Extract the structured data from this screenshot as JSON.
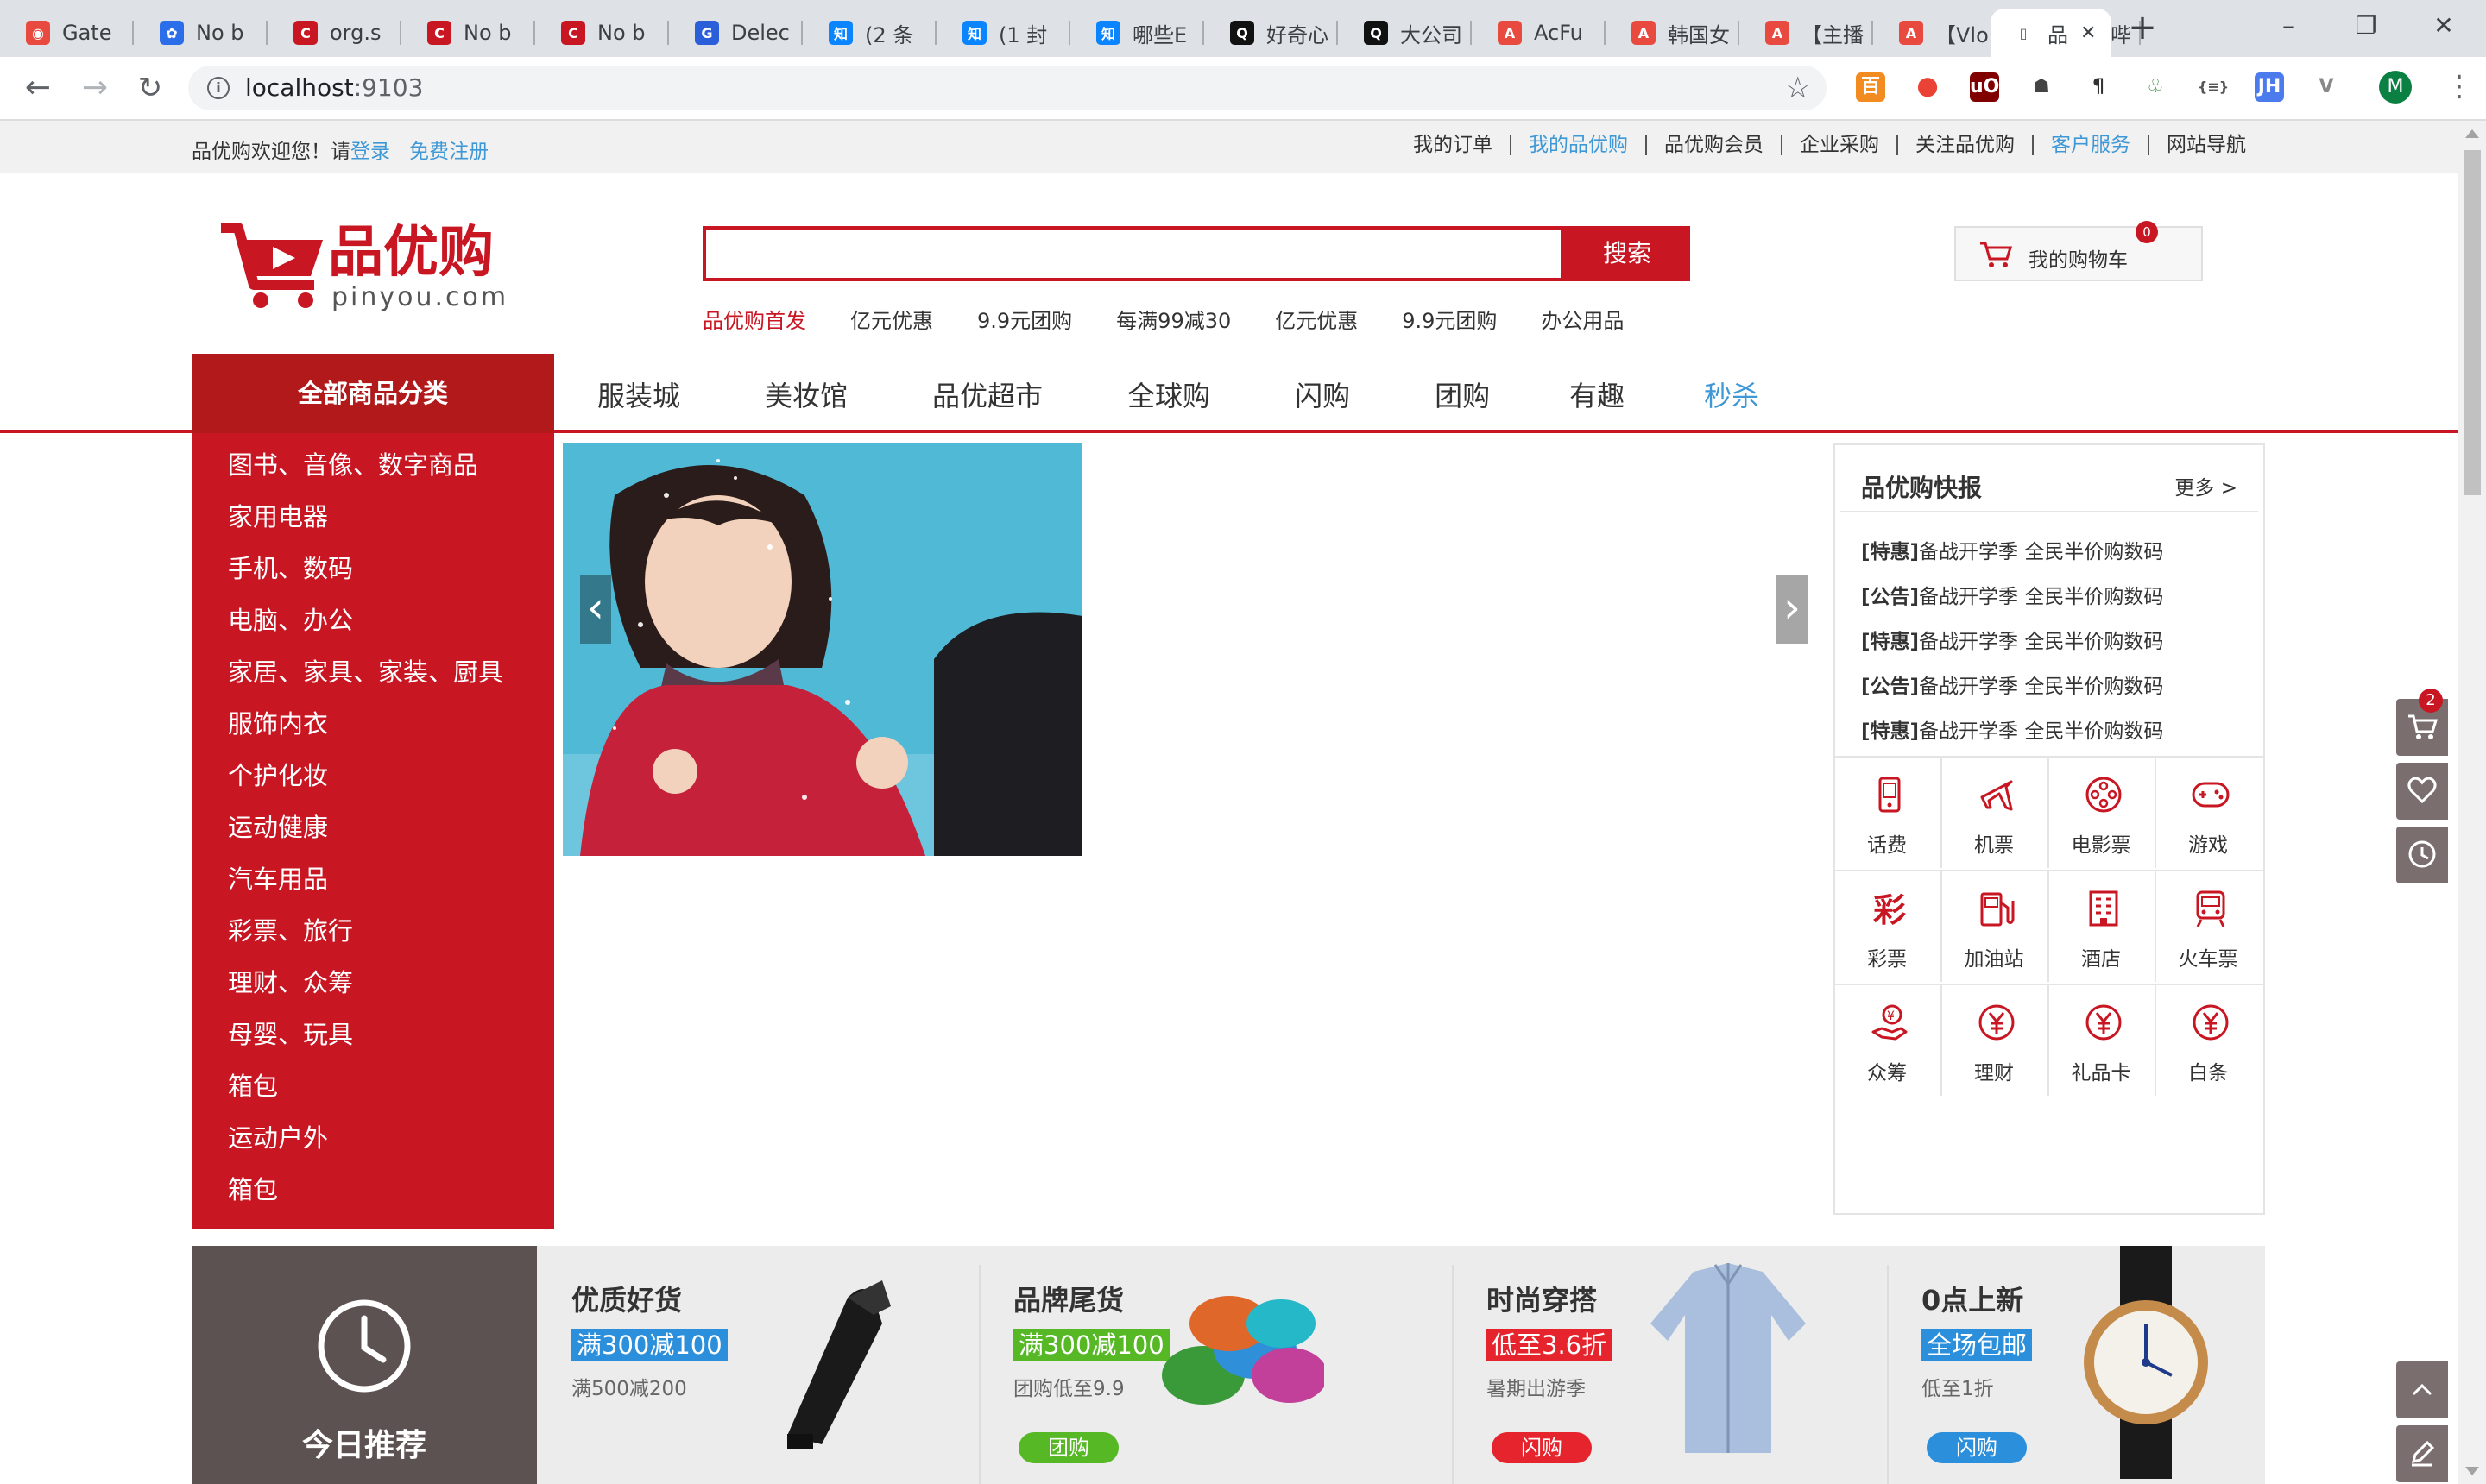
{
  "browser": {
    "tabs": [
      {
        "label": "Gate",
        "icon": "bilibili-icon",
        "color": "#e94a3f"
      },
      {
        "label": "No b",
        "icon": "baidu-icon",
        "color": "#2c6eea"
      },
      {
        "label": "org.s",
        "icon": "csdn-icon",
        "color": "#c81623"
      },
      {
        "label": "No b",
        "icon": "csdn-icon",
        "color": "#c81623"
      },
      {
        "label": "No b",
        "icon": "csdn-icon",
        "color": "#c81623"
      },
      {
        "label": "Delec",
        "icon": "google-icon",
        "color": "#2b5fd9"
      },
      {
        "label": "(2 条",
        "icon": "zhihu-icon",
        "color": "#0a84ff"
      },
      {
        "label": "(1 封",
        "icon": "zhihu-icon",
        "color": "#0a84ff"
      },
      {
        "label": "哪些E",
        "icon": "zhihu-icon",
        "color": "#0a84ff"
      },
      {
        "label": "好奇心",
        "icon": "qdaily-icon",
        "color": "#111111"
      },
      {
        "label": "大公司",
        "icon": "qdaily-icon",
        "color": "#111111"
      },
      {
        "label": "AcFu",
        "icon": "acfun-icon",
        "color": "#e94a3f"
      },
      {
        "label": "韩国女",
        "icon": "acfun-icon",
        "color": "#e94a3f"
      },
      {
        "label": "【主播",
        "icon": "acfun-icon",
        "color": "#e94a3f"
      },
      {
        "label": "【Vlo",
        "icon": "acfun-icon",
        "color": "#e94a3f"
      },
      {
        "label": "哔哩哔",
        "icon": "bilibili-tv-icon",
        "color": "#23ade5"
      },
      {
        "label": "品",
        "icon": "page-icon",
        "color": "#5f6368"
      }
    ],
    "url_host": "localhost",
    "url_port": ":9103",
    "extensions": [
      {
        "icon": "extension-orange-icon",
        "color": "#f28b20"
      },
      {
        "icon": "location-pin-icon",
        "color": "#ea4335"
      },
      {
        "icon": "ublock-icon",
        "color": "#800000"
      },
      {
        "icon": "spy-icon",
        "color": "#444444"
      },
      {
        "icon": "paragraph-icon",
        "color": "#333333"
      },
      {
        "icon": "leaf-icon",
        "color": "#2e7d32"
      },
      {
        "icon": "json-icon",
        "color": "#555555"
      },
      {
        "icon": "jh-icon",
        "color": "#4b7bec"
      },
      {
        "icon": "vue-icon",
        "color": "#888888"
      }
    ],
    "avatar_letter": "M"
  },
  "shortcut": {
    "welcome": "品优购欢迎您！请",
    "login": "登录",
    "register": "免费注册",
    "links": [
      "我的订单",
      "我的品优购",
      "品优购会员",
      "企业采购",
      "关注品优购",
      "客户服务",
      "网站导航"
    ]
  },
  "header": {
    "logo_cn": "品优购",
    "logo_en": "pinyou.com",
    "search_placeholder": "",
    "search_button": "搜索",
    "hotwords": [
      "品优购首发",
      "亿元优惠",
      "9.9元团购",
      "每满99减30",
      "亿元优惠",
      "9.9元团购",
      "办公用品"
    ],
    "cart_label": "我的购物车",
    "cart_count": "0"
  },
  "nav": {
    "category_title": "全部商品分类",
    "items": [
      "服装城",
      "美妆馆",
      "品优超市",
      "全球购",
      "闪购",
      "团购",
      "有趣",
      "秒杀"
    ]
  },
  "categories": [
    "图书、音像、数字商品",
    "家用电器",
    "手机、数码",
    "电脑、办公",
    "家居、家具、家装、厨具",
    "服饰内衣",
    "个护化妆",
    "运动健康",
    "汽车用品",
    "彩票、旅行",
    "理财、众筹",
    "母婴、玩具",
    "箱包",
    "运动户外",
    "箱包"
  ],
  "banner": {
    "prev": "‹",
    "next": "›"
  },
  "news": {
    "title": "品优购快报",
    "more": "更多 >",
    "items": [
      {
        "tag": "[特惠]",
        "text": "备战开学季 全民半价购数码"
      },
      {
        "tag": "[公告]",
        "text": "备战开学季 全民半价购数码"
      },
      {
        "tag": "[特惠]",
        "text": "备战开学季 全民半价购数码"
      },
      {
        "tag": "[公告]",
        "text": "备战开学季 全民半价购数码"
      },
      {
        "tag": "[特惠]",
        "text": "备战开学季 全民半价购数码"
      }
    ]
  },
  "services": [
    {
      "label": "话费",
      "icon": "phone-icon"
    },
    {
      "label": "机票",
      "icon": "airplane-icon"
    },
    {
      "label": "电影票",
      "icon": "film-reel-icon"
    },
    {
      "label": "游戏",
      "icon": "gamepad-icon"
    },
    {
      "label": "彩票",
      "icon": "lottery-icon"
    },
    {
      "label": "加油站",
      "icon": "gas-station-icon"
    },
    {
      "label": "酒店",
      "icon": "hotel-icon"
    },
    {
      "label": "火车票",
      "icon": "train-icon"
    },
    {
      "label": "众筹",
      "icon": "crowdfund-icon"
    },
    {
      "label": "理财",
      "icon": "yuan-coin-icon"
    },
    {
      "label": "礼品卡",
      "icon": "yuan-coin-icon"
    },
    {
      "label": "白条",
      "icon": "yuan-coin-icon"
    }
  ],
  "recommend": {
    "title": "今日推荐",
    "items": [
      {
        "title": "优质好货",
        "tag": "满300减100",
        "tag_color": "#2b8fdb",
        "sub": "满500减200",
        "pill": "",
        "pill_color": "",
        "image": "vacuum-image"
      },
      {
        "title": "品牌尾货",
        "tag": "满300减100",
        "tag_color": "#55b824",
        "sub": "团购低至9.9",
        "pill": "团购",
        "pill_color": "#55b824",
        "image": "towels-image"
      },
      {
        "title": "时尚穿搭",
        "tag": "低至3.6折",
        "tag_color": "#e6242e",
        "sub": "暑期出游季",
        "pill": "闪购",
        "pill_color": "#e6242e",
        "image": "shirt-image"
      },
      {
        "title": "0点上新",
        "tag": "全场包邮",
        "tag_color": "#2b8fdb",
        "sub": "低至1折",
        "pill": "闪购",
        "pill_color": "#2b8fdb",
        "image": "watch-image"
      }
    ]
  },
  "sidebar": {
    "cart_badge": "2"
  }
}
